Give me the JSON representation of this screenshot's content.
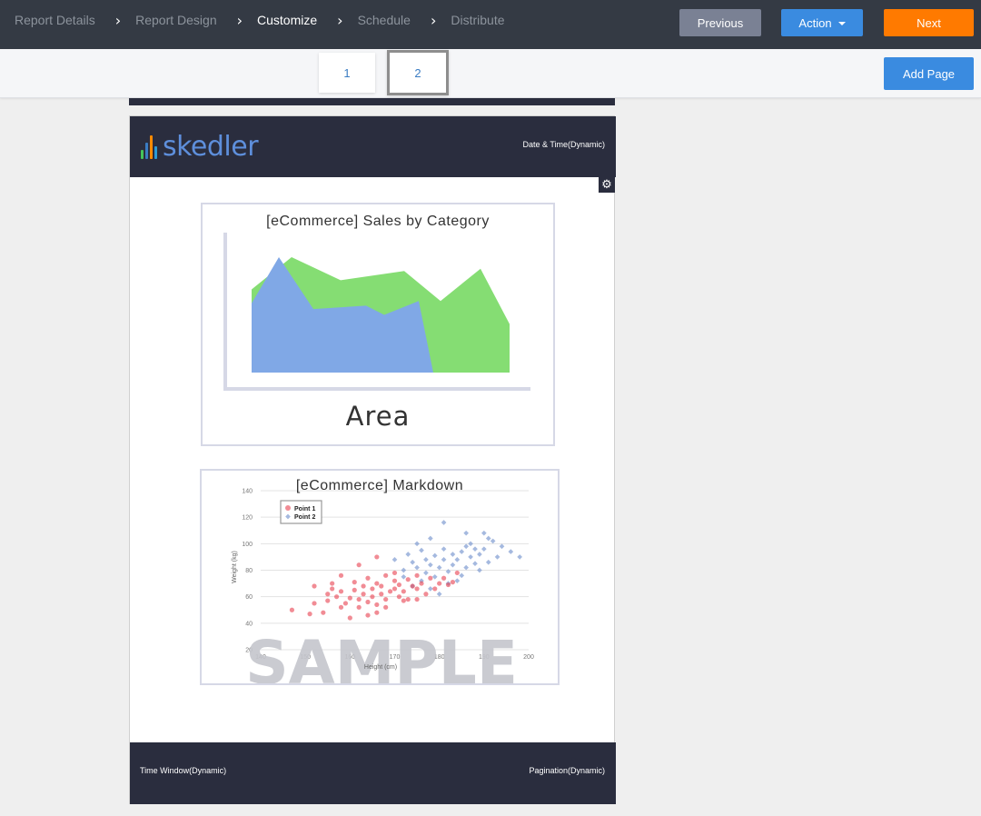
{
  "nav": {
    "steps": [
      "Report Details",
      "Report Design",
      "Customize",
      "Schedule",
      "Distribute"
    ],
    "active_step": "Customize",
    "previous_label": "Previous",
    "action_label": "Action",
    "next_label": "Next"
  },
  "pages": {
    "tabs": [
      "1",
      "2"
    ],
    "selected": "2",
    "add_page_label": "Add Page"
  },
  "report": {
    "logo_text": "skedler",
    "logo_bar_colors": [
      "#45c45a",
      "#3a7cc3",
      "#ff8a00",
      "#2a9ad8"
    ],
    "header_right": "Date & Time(Dynamic)",
    "footer_left": "Time Window(Dynamic)",
    "footer_right": "Pagination(Dynamic)",
    "settings_icon": "gear-icon"
  },
  "panels": {
    "area": {
      "title": "[eCommerce] Sales by Category",
      "caption": "Area",
      "colors": {
        "green": "#85dd73",
        "blue": "#80a8e6",
        "axis": "#d6d8e6"
      }
    },
    "scatter": {
      "title": "[eCommerce] Markdown",
      "watermark": "SAMPLE",
      "colors": {
        "point1": "#e8404f",
        "point2": "#7f9bd1",
        "watermark": "#c4c5cc"
      }
    }
  },
  "chart_data": [
    {
      "type": "area",
      "title": "[eCommerce] Sales by Category",
      "caption": "Area",
      "series": [
        {
          "values": [
            60,
            100,
            55,
            58,
            50,
            62,
            25
          ]
        },
        {
          "values": [
            72,
            100,
            80,
            88,
            62,
            90,
            42
          ]
        }
      ]
    },
    {
      "type": "scatter",
      "title": "[eCommerce] Markdown",
      "xlabel": "Height (cm)",
      "ylabel": "Weight (kg)",
      "xlim": [
        140,
        200
      ],
      "ylim": [
        20,
        140
      ],
      "xticks": [
        140,
        150,
        160,
        170,
        180,
        190,
        200
      ],
      "yticks": [
        20,
        40,
        60,
        80,
        100,
        120,
        140
      ],
      "legend": [
        "Point 1",
        "Point 2"
      ],
      "legend_position": "top-left",
      "grid": true,
      "series": [
        {
          "name": "Point 1",
          "points": [
            [
              147,
              50
            ],
            [
              151,
              47
            ],
            [
              152,
              55
            ],
            [
              154,
              48
            ],
            [
              155,
              57
            ],
            [
              156,
              66
            ],
            [
              157,
              60
            ],
            [
              158,
              52
            ],
            [
              159,
              55
            ],
            [
              160,
              59
            ],
            [
              161,
              65
            ],
            [
              161,
              71
            ],
            [
              162,
              58
            ],
            [
              163,
              62
            ],
            [
              163,
              68
            ],
            [
              164,
              74
            ],
            [
              164,
              56
            ],
            [
              165,
              60
            ],
            [
              165,
              66
            ],
            [
              166,
              70
            ],
            [
              166,
              54
            ],
            [
              167,
              62
            ],
            [
              167,
              68
            ],
            [
              168,
              76
            ],
            [
              168,
              58
            ],
            [
              169,
              64
            ],
            [
              170,
              66
            ],
            [
              170,
              72
            ],
            [
              171,
              60
            ],
            [
              171,
              69
            ],
            [
              172,
              64
            ],
            [
              173,
              73
            ],
            [
              173,
              58
            ],
            [
              174,
              68
            ],
            [
              175,
              66
            ],
            [
              175,
              76
            ],
            [
              176,
              70
            ],
            [
              177,
              62
            ],
            [
              178,
              74
            ],
            [
              179,
              66
            ],
            [
              180,
              70
            ],
            [
              181,
              74
            ],
            [
              182,
              69
            ],
            [
              183,
              71
            ],
            [
              184,
              78
            ],
            [
              158,
              76
            ],
            [
              162,
              84
            ],
            [
              166,
              90
            ],
            [
              160,
              44
            ],
            [
              164,
              46
            ],
            [
              168,
              52
            ],
            [
              172,
              57
            ],
            [
              158,
              64
            ],
            [
              156,
              70
            ],
            [
              170,
              78
            ],
            [
              175,
              58
            ],
            [
              152,
              68
            ],
            [
              155,
              62
            ],
            [
              162,
              52
            ],
            [
              166,
              48
            ]
          ]
        },
        {
          "name": "Point 2",
          "points": [
            [
              170,
              88
            ],
            [
              172,
              80
            ],
            [
              173,
              92
            ],
            [
              174,
              86
            ],
            [
              175,
              82
            ],
            [
              176,
              95
            ],
            [
              177,
              78
            ],
            [
              177,
              88
            ],
            [
              178,
              84
            ],
            [
              179,
              91
            ],
            [
              179,
              75
            ],
            [
              180,
              82
            ],
            [
              181,
              88
            ],
            [
              181,
              96
            ],
            [
              182,
              79
            ],
            [
              183,
              84
            ],
            [
              183,
              92
            ],
            [
              184,
              88
            ],
            [
              185,
              76
            ],
            [
              185,
              94
            ],
            [
              186,
              82
            ],
            [
              187,
              90
            ],
            [
              187,
              100
            ],
            [
              188,
              85
            ],
            [
              189,
              92
            ],
            [
              189,
              80
            ],
            [
              190,
              96
            ],
            [
              191,
              86
            ],
            [
              192,
              102
            ],
            [
              193,
              90
            ],
            [
              174,
              68
            ],
            [
              176,
              72
            ],
            [
              178,
              66
            ],
            [
              180,
              62
            ],
            [
              182,
              70
            ],
            [
              184,
              72
            ],
            [
              175,
              100
            ],
            [
              178,
              104
            ],
            [
              181,
              116
            ],
            [
              186,
              108
            ],
            [
              191,
              104
            ],
            [
              194,
              98
            ],
            [
              196,
              94
            ],
            [
              198,
              90
            ],
            [
              172,
              75
            ],
            [
              186,
              98
            ],
            [
              188,
              96
            ],
            [
              190,
              108
            ]
          ]
        }
      ]
    }
  ]
}
